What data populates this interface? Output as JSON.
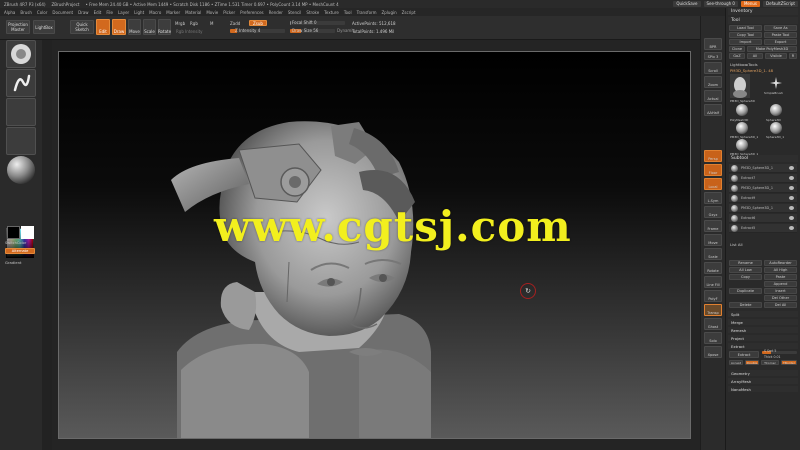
{
  "titlebar": {
    "items": [
      "ZBrush 4R7 P3 (x64)",
      "ZBrushProject",
      "• Free Mem 24.40 GB • Active Mem 1449 • Scratch Disk 1186 • ZTime 1.531 Timer 0.697 • PolyCount 3.14 MP • MeshCount 4"
    ],
    "quicksave": "QuickSave",
    "see_through": "See-through 0",
    "menus": "Menus",
    "default_script": "DefaultZScript"
  },
  "menubar": {
    "items": [
      "Alpha",
      "Brush",
      "Color",
      "Document",
      "Draw",
      "Edit",
      "File",
      "Layer",
      "Light",
      "Macro",
      "Marker",
      "Material",
      "Movie",
      "Picker",
      "Preferences",
      "Render",
      "Stencil",
      "Stroke",
      "Texture",
      "Tool",
      "Transform",
      "Zplugin",
      "Zscript"
    ],
    "right_label": "Inventory"
  },
  "toolbar": {
    "projection_master": "Projection Master",
    "lightbox": "LightBox",
    "quick_sketch": "Quick Sketch",
    "edit": "Edit",
    "draw": "Draw",
    "move": "Move",
    "scale": "Scale",
    "rotate": "Rotate",
    "mrgb": "Mrgb",
    "rgb": "Rgb",
    "m": "M",
    "zadd": "Zadd",
    "zsub": "Zsub",
    "rgb_intensity": "Rgb Intensity",
    "z_intensity": "Z Intensity 4",
    "focal_shift": "Focal Shift 0",
    "draw_size": "Draw Size 56",
    "dynamic": "Dynamic",
    "active_points": "ActivePoints: 512,618",
    "total_points": "TotalPoints: 1.496 Mil"
  },
  "left_shelf": {
    "gradient": "Gradient",
    "switch_color": "SwitchColor",
    "alternate": "Alternate"
  },
  "canvas": {
    "watermark": "www.cgtsj.com"
  },
  "right_shelf": {
    "buttons": [
      "BPR",
      "SPix 3",
      "Scroll",
      "Zoom",
      "Actual",
      "AAHalf",
      "Persp",
      "Floor",
      "Local",
      "L.Sym",
      "Gxyz",
      "Frame",
      "Move",
      "Scale",
      "Rotate",
      "Line Fill",
      "PolyF",
      "Transp",
      "Ghost",
      "Solo",
      "Xpose"
    ]
  },
  "right_panel": {
    "inventory": "Inventory",
    "tool_header": "Tool",
    "load_tool": "Load Tool",
    "save_as": "Save As",
    "copy_tool": "Copy Tool",
    "paste_tool": "Paste Tool",
    "import": "Import",
    "export": "Export",
    "clone": "Clone",
    "make_polymesh": "Make PolyMesh3D",
    "goz": "GoZ",
    "all": "All",
    "visible": "Visible",
    "r": "R",
    "lightbox_tools": "Lightbox▸Tools",
    "current_tool": "PM3D_Sphere3D_1. 48",
    "tools": [
      "PM3D_Sphere3D",
      "SimpleBrush",
      "PolyMesh3D",
      "Sphere3D",
      "PM3D_Sphere3D_1",
      "Sphere3D_1",
      "PM3D_Sphere3D_1"
    ],
    "subtool": "Subtool",
    "subtools": [
      "PM3D_Sphere3D_1",
      "Extract7",
      "PM3D_Sphere3D_1",
      "Extract9",
      "PM3D_Sphere3D_1",
      "Extract6",
      "Extract5"
    ],
    "list_all": "List All",
    "rename": "Rename",
    "autoreorder": "AutoReorder",
    "all_low": "All Low",
    "all_high": "All High",
    "copy": "Copy",
    "paste": "Paste",
    "append": "Append",
    "duplicate": "Duplicate",
    "insert": "Insert",
    "del_other": "Del Other",
    "delete": "Delete",
    "del_all": "Del All",
    "split": "Split",
    "merge": "Merge",
    "remesh": "Remesh",
    "project": "Project",
    "extract": "Extract",
    "extract_btn": "Extract",
    "s_smt": "S Smt 5",
    "thick": "Thick 0.01",
    "accept": "Accept",
    "double": "Double",
    "tcorner": "TCorner",
    "tborder": "TBorder",
    "geometry": "Geometry",
    "arraymesh": "ArrayMesh",
    "nanomesh": "NanoMesh"
  },
  "colors": {
    "accent": "#d2691e",
    "watermark": "#f2ef1e"
  }
}
